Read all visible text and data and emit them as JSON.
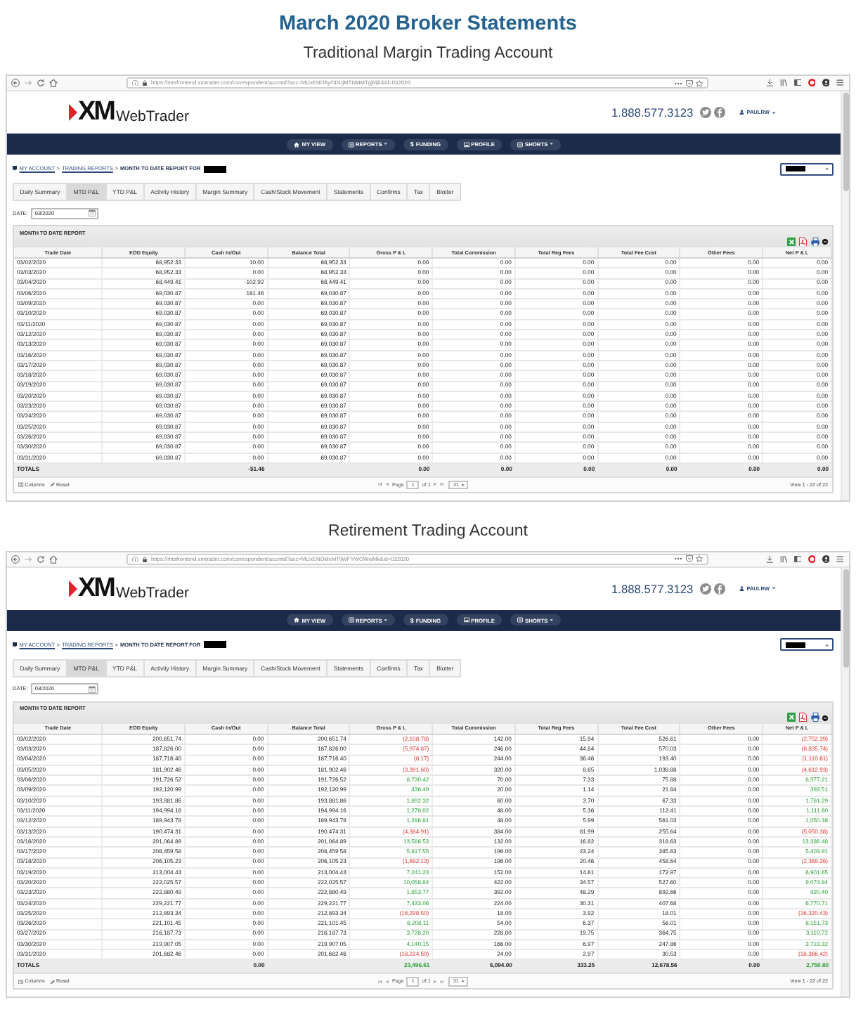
{
  "title": "March 2020 Broker Statements",
  "accounts": [
    {
      "heading": "Traditional Margin Trading Account",
      "browser": {
        "url": "https://mtsfrontend.xmtrader.com/correspondent/accmtd?acc=MUxENDAyODUjMTNMMTgjMjk&id=032020"
      },
      "site": {
        "logo_mark": "XM",
        "logo_text": "WebTrader",
        "phone": "1.888.577.3123",
        "user": "PAULRW"
      },
      "nav": [
        {
          "label": "MY VIEW",
          "kind": "home",
          "dropdown": false
        },
        {
          "label": "REPORTS",
          "kind": "list",
          "dropdown": true
        },
        {
          "label": "FUNDING",
          "kind": "glyph",
          "glyph": "$",
          "dropdown": false
        },
        {
          "label": "PROFILE",
          "kind": "picture",
          "dropdown": false
        },
        {
          "label": "SHORTS",
          "kind": "list",
          "dropdown": true
        }
      ],
      "breadcrumb": [
        {
          "label": "MY ACCOUNT",
          "kind": "link"
        },
        {
          "label": ">",
          "kind": "separator"
        },
        {
          "label": "TRADING REPORTS",
          "kind": "link"
        },
        {
          "label": ">",
          "kind": "separator"
        },
        {
          "label": "MONTH TO DATE REPORT FOR",
          "kind": "current"
        }
      ],
      "tabs": [
        {
          "label": "Daily Summary",
          "selected": false
        },
        {
          "label": "MTD P&L",
          "selected": true
        },
        {
          "label": "YTD P&L",
          "selected": false
        },
        {
          "label": "Activity History",
          "selected": false
        },
        {
          "label": "Margin Summary",
          "selected": false
        },
        {
          "label": "Cash/Stock Movement",
          "selected": false
        },
        {
          "label": "Statements",
          "selected": false
        },
        {
          "label": "Confirms",
          "selected": false
        },
        {
          "label": "Tax",
          "selected": false
        },
        {
          "label": "Blotter",
          "selected": false
        }
      ],
      "date": {
        "label": "DATE:",
        "value": "03/2020"
      },
      "report": {
        "title": "MONTH TO DATE REPORT",
        "columns": [
          "Trade Date",
          "EOD Equity",
          "Cash In/Out",
          "Balance Total",
          "Gross P & L",
          "Total Commission",
          "Total Reg Fees",
          "Total Fee Cost",
          "Other Fees",
          "Net P & L"
        ],
        "rows": [
          {
            "cells": [
              "03/02/2020",
              "68,952.33",
              "10.00",
              "68,952.33",
              "0.00",
              "0.00",
              "0.00",
              "0.00",
              "0.00",
              "0.00"
            ]
          },
          {
            "cells": [
              "03/03/2020",
              "68,952.33",
              "0.00",
              "68,952.33",
              "0.00",
              "0.00",
              "0.00",
              "0.00",
              "0.00",
              "0.00"
            ]
          },
          {
            "cells": [
              "03/04/2020",
              "68,449.41",
              "-102.92",
              "68,449.41",
              "0.00",
              "0.00",
              "0.00",
              "0.00",
              "0.00",
              "0.00"
            ]
          },
          {
            "cells": [
              "03/06/2020",
              "69,030.87",
              "181.46",
              "69,030.87",
              "0.00",
              "0.00",
              "0.00",
              "0.00",
              "0.00",
              "0.00"
            ]
          },
          {
            "cells": [
              "03/09/2020",
              "69,030.87",
              "0.00",
              "69,030.87",
              "0.00",
              "0.00",
              "0.00",
              "0.00",
              "0.00",
              "0.00"
            ]
          },
          {
            "cells": [
              "03/10/2020",
              "69,030.87",
              "0.00",
              "69,030.87",
              "0.00",
              "0.00",
              "0.00",
              "0.00",
              "0.00",
              "0.00"
            ]
          },
          {
            "cells": [
              "03/11/2020",
              "69,030.87",
              "0.00",
              "69,030.87",
              "0.00",
              "0.00",
              "0.00",
              "0.00",
              "0.00",
              "0.00"
            ]
          },
          {
            "cells": [
              "03/12/2020",
              "69,030.87",
              "0.00",
              "69,030.87",
              "0.00",
              "0.00",
              "0.00",
              "0.00",
              "0.00",
              "0.00"
            ]
          },
          {
            "cells": [
              "03/13/2020",
              "69,030.87",
              "0.00",
              "69,030.87",
              "0.00",
              "0.00",
              "0.00",
              "0.00",
              "0.00",
              "0.00"
            ]
          },
          {
            "cells": [
              "03/16/2020",
              "69,030.87",
              "0.00",
              "69,030.87",
              "0.00",
              "0.00",
              "0.00",
              "0.00",
              "0.00",
              "0.00"
            ]
          },
          {
            "cells": [
              "03/17/2020",
              "69,030.87",
              "0.00",
              "69,030.87",
              "0.00",
              "0.00",
              "0.00",
              "0.00",
              "0.00",
              "0.00"
            ]
          },
          {
            "cells": [
              "03/18/2020",
              "69,030.87",
              "0.00",
              "69,030.87",
              "0.00",
              "0.00",
              "0.00",
              "0.00",
              "0.00",
              "0.00"
            ]
          },
          {
            "cells": [
              "03/19/2020",
              "69,030.87",
              "0.00",
              "69,030.87",
              "0.00",
              "0.00",
              "0.00",
              "0.00",
              "0.00",
              "0.00"
            ]
          },
          {
            "cells": [
              "03/20/2020",
              "69,030.87",
              "0.00",
              "69,030.87",
              "0.00",
              "0.00",
              "0.00",
              "0.00",
              "0.00",
              "0.00"
            ]
          },
          {
            "cells": [
              "03/23/2020",
              "69,030.87",
              "0.00",
              "69,030.87",
              "0.00",
              "0.00",
              "0.00",
              "0.00",
              "0.00",
              "0.00"
            ]
          },
          {
            "cells": [
              "03/24/2020",
              "69,030.87",
              "0.00",
              "69,030.87",
              "0.00",
              "0.00",
              "0.00",
              "0.00",
              "0.00",
              "0.00"
            ]
          },
          {
            "cells": [
              "03/25/2020",
              "69,030.87",
              "0.00",
              "69,030.87",
              "0.00",
              "0.00",
              "0.00",
              "0.00",
              "0.00",
              "0.00"
            ]
          },
          {
            "cells": [
              "03/26/2020",
              "69,030.87",
              "0.00",
              "69,030.87",
              "0.00",
              "0.00",
              "0.00",
              "0.00",
              "0.00",
              "0.00"
            ]
          },
          {
            "cells": [
              "03/30/2020",
              "69,030.87",
              "0.00",
              "69,030.87",
              "0.00",
              "0.00",
              "0.00",
              "0.00",
              "0.00",
              "0.00"
            ]
          },
          {
            "cells": [
              "03/31/2020",
              "69,030.87",
              "0.00",
              "69,030.87",
              "0.00",
              "0.00",
              "0.00",
              "0.00",
              "0.00",
              "0.00"
            ]
          }
        ],
        "totals": {
          "label": "TOTALS",
          "cash_in_out": "-51.46",
          "gross_pl": "0.00",
          "total_commission": "0.00",
          "total_reg_fees": "0.00",
          "total_fee_cost": "0.00",
          "other_fees": "0.00",
          "net_pl": "0.00"
        },
        "footer": {
          "columns_label": "Columns",
          "reset_label": "Reset",
          "page_label": "Page",
          "page": "1",
          "page_count_label": "of 1",
          "page_size": "31",
          "summary": "View 1 - 22 of 22"
        }
      }
    },
    {
      "heading": "Retirement Trading Account",
      "browser": {
        "url": "https://mtsfrontend.xmtrader.com/correspondent/accmtd?acc=MUxENDMxMTljWFYWOWwMk&id=032020"
      },
      "site": {
        "logo_mark": "XM",
        "logo_text": "WebTrader",
        "phone": "1.888.577.3123",
        "user": "PAULRW"
      },
      "nav": [
        {
          "label": "MY VIEW",
          "kind": "home",
          "dropdown": false
        },
        {
          "label": "REPORTS",
          "kind": "list",
          "dropdown": true
        },
        {
          "label": "FUNDING",
          "kind": "glyph",
          "glyph": "$",
          "dropdown": false
        },
        {
          "label": "PROFILE",
          "kind": "picture",
          "dropdown": false
        },
        {
          "label": "SHORTS",
          "kind": "list",
          "dropdown": true
        }
      ],
      "breadcrumb": [
        {
          "label": "MY ACCOUNT",
          "kind": "link"
        },
        {
          "label": ">",
          "kind": "separator"
        },
        {
          "label": "TRADING REPORTS",
          "kind": "link"
        },
        {
          "label": ">",
          "kind": "separator"
        },
        {
          "label": "MONTH TO DATE REPORT FOR",
          "kind": "current"
        }
      ],
      "tabs": [
        {
          "label": "Daily Summary",
          "selected": false
        },
        {
          "label": "MTD P&L",
          "selected": true
        },
        {
          "label": "YTD P&L",
          "selected": false
        },
        {
          "label": "Activity History",
          "selected": false
        },
        {
          "label": "Margin Summary",
          "selected": false
        },
        {
          "label": "Cash/Stock Movement",
          "selected": false
        },
        {
          "label": "Statements",
          "selected": false
        },
        {
          "label": "Confirms",
          "selected": false
        },
        {
          "label": "Tax",
          "selected": false
        },
        {
          "label": "Blotter",
          "selected": false
        }
      ],
      "date": {
        "label": "DATE:",
        "value": "03/2020"
      },
      "report": {
        "title": "MONTH TO DATE REPORT",
        "columns": [
          "Trade Date",
          "EOD Equity",
          "Cash In/Out",
          "Balance Total",
          "Gross P & L",
          "Total Commission",
          "Total Reg Fees",
          "Total Fee Cost",
          "Other Fees",
          "Net P & L"
        ],
        "rows": [
          {
            "cells": [
              "03/02/2020",
              "200,651.74",
              "0.00",
              "200,651.74",
              "(2,108.78)",
              "142.00",
              "15.94",
              "526.61",
              "0.00",
              "(2,752.39)"
            ],
            "loss": true,
            "gain": false
          },
          {
            "cells": [
              "03/03/2020",
              "187,826.00",
              "0.00",
              "187,826.00",
              "(5,974.87)",
              "246.00",
              "44.84",
              "570.03",
              "0.00",
              "(6,835.74)"
            ],
            "loss": true,
            "gain": false
          },
          {
            "cells": [
              "03/04/2020",
              "187,716.40",
              "0.00",
              "187,716.40",
              "(8.17)",
              "244.00",
              "36.46",
              "193.40",
              "0.00",
              "(1,110.61)"
            ],
            "loss": true,
            "gain": false
          },
          {
            "cells": [
              "03/05/2020",
              "181,902.46",
              "0.00",
              "181,902.46",
              "(3,391.60)",
              "320.00",
              "8.65",
              "1,038.88",
              "0.00",
              "(4,612.93)"
            ],
            "loss": true,
            "gain": false
          },
          {
            "cells": [
              "03/06/2020",
              "191,726.52",
              "0.00",
              "191,726.52",
              "8,730.42",
              "70.00",
              "7.33",
              "75.88",
              "0.00",
              "8,577.21"
            ],
            "loss": false,
            "gain": true
          },
          {
            "cells": [
              "03/09/2020",
              "192,120.99",
              "0.00",
              "192,120.99",
              "436.49",
              "20.00",
              "1.14",
              "21.84",
              "0.00",
              "393.51"
            ],
            "loss": false,
            "gain": true
          },
          {
            "cells": [
              "03/10/2020",
              "193,881.86",
              "0.00",
              "193,881.86",
              "1,892.32",
              "60.00",
              "3.70",
              "67.33",
              "0.00",
              "1,761.29"
            ],
            "loss": false,
            "gain": true
          },
          {
            "cells": [
              "03/11/2020",
              "194,994.16",
              "0.00",
              "194,994.16",
              "1,278.02",
              "48.00",
              "5.36",
              "112.41",
              "0.00",
              "1,111.60"
            ],
            "loss": false,
            "gain": true
          },
          {
            "cells": [
              "03/12/2020",
              "189,943.78",
              "0.00",
              "189,943.78",
              "1,286.81",
              "48.00",
              "5.99",
              "561.03",
              "0.00",
              "1,050.38"
            ],
            "loss": false,
            "gain": true
          },
          {
            "cells": [
              "03/13/2020",
              "190,474.31",
              "0.00",
              "190,474.31",
              "(4,384.91)",
              "384.00",
              "81.99",
              "255.64",
              "0.00",
              "(5,050.38)"
            ],
            "loss": true,
            "gain": false
          },
          {
            "cells": [
              "03/16/2020",
              "201,064.89",
              "0.00",
              "201,064.89",
              "13,566.53",
              "132.00",
              "16.82",
              "318.63",
              "0.00",
              "13,336.48"
            ],
            "loss": false,
            "gain": true
          },
          {
            "cells": [
              "03/17/2020",
              "208,459.58",
              "0.00",
              "208,459.58",
              "5,817.55",
              "196.00",
              "23.24",
              "385.63",
              "0.00",
              "5,403.91"
            ],
            "loss": false,
            "gain": true
          },
          {
            "cells": [
              "03/18/2020",
              "206,105.23",
              "0.00",
              "206,105.23",
              "(1,682.13)",
              "196.00",
              "20.46",
              "458.64",
              "0.00",
              "(2,368.26)"
            ],
            "loss": true,
            "gain": false
          },
          {
            "cells": [
              "03/19/2020",
              "213,004.43",
              "0.00",
              "213,004.43",
              "7,241.23",
              "152.00",
              "14.61",
              "172.97",
              "0.00",
              "6,901.65"
            ],
            "loss": false,
            "gain": true
          },
          {
            "cells": [
              "03/20/2020",
              "222,025.57",
              "0.00",
              "222,025.57",
              "10,058.84",
              "422.00",
              "34.57",
              "527.60",
              "0.00",
              "9,074.84"
            ],
            "loss": false,
            "gain": true
          },
          {
            "cells": [
              "03/23/2020",
              "222,880.49",
              "0.00",
              "222,880.49",
              "1,853.77",
              "392.00",
              "48.29",
              "892.66",
              "0.00",
              "920.40"
            ],
            "loss": false,
            "gain": true
          },
          {
            "cells": [
              "03/24/2020",
              "229,221.77",
              "0.00",
              "229,221.77",
              "7,433.06",
              "224.00",
              "30.31",
              "407.68",
              "0.00",
              "6,770.71"
            ],
            "loss": false,
            "gain": true
          },
          {
            "cells": [
              "03/25/2020",
              "212,893.34",
              "0.00",
              "212,893.34",
              "(16,298.50)",
              "18.00",
              "3.92",
              "18.01",
              "0.00",
              "(16,320.43)"
            ],
            "loss": true,
            "gain": false
          },
          {
            "cells": [
              "03/26/2020",
              "221,101.45",
              "0.00",
              "221,101.45",
              "8,208.11",
              "54.00",
              "6.37",
              "56.01",
              "0.00",
              "8,151.73"
            ],
            "loss": false,
            "gain": true
          },
          {
            "cells": [
              "03/27/2020",
              "216,187.73",
              "0.00",
              "216,187.73",
              "3,728.20",
              "228.00",
              "19.75",
              "364.75",
              "0.00",
              "3,110.72"
            ],
            "loss": false,
            "gain": true
          },
          {
            "cells": [
              "03/30/2020",
              "219,907.05",
              "0.00",
              "219,907.05",
              "4,140.15",
              "166.00",
              "6.97",
              "247.86",
              "0.00",
              "3,719.32"
            ],
            "loss": false,
            "gain": true
          },
          {
            "cells": [
              "03/31/2020",
              "201,682.46",
              "0.00",
              "201,682.46",
              "(18,224.59)",
              "24.00",
              "2.97",
              "30.53",
              "0.00",
              "(18,366.42)"
            ],
            "loss": true,
            "gain": false
          }
        ],
        "totals": {
          "label": "TOTALS",
          "cash_in_out": "0.00",
          "gross_pl": "23,496.61",
          "total_commission": "6,094.00",
          "total_reg_fees": "333.25",
          "total_fee_cost": "12,678.56",
          "other_fees": "0.00",
          "net_pl": "2,750.80",
          "loss": false,
          "gain": true
        },
        "footer": {
          "columns_label": "Columns",
          "reset_label": "Reset",
          "page_label": "Page",
          "page": "1",
          "page_count_label": "of 1",
          "page_size": "31",
          "summary": "View 1 - 22 of 22"
        }
      }
    }
  ]
}
